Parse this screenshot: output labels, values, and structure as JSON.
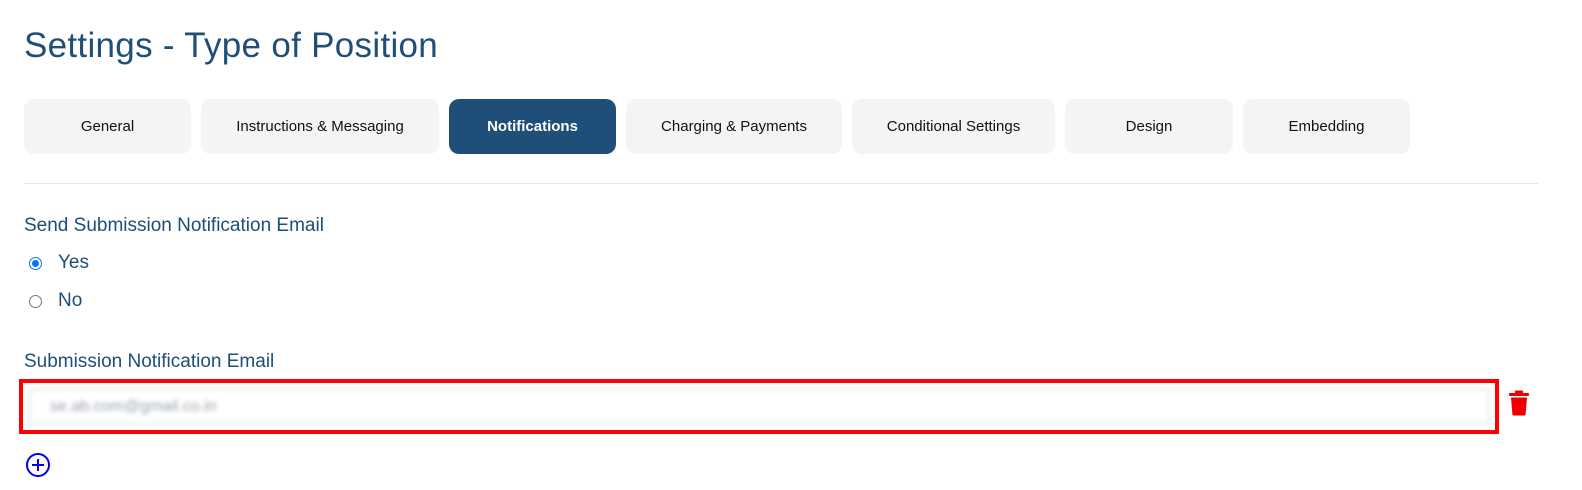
{
  "page": {
    "title": "Settings - Type of Position"
  },
  "tabs": [
    {
      "label": "General",
      "active": false
    },
    {
      "label": "Instructions & Messaging",
      "active": false
    },
    {
      "label": "Notifications",
      "active": true
    },
    {
      "label": "Charging & Payments",
      "active": false
    },
    {
      "label": "Conditional Settings",
      "active": false
    },
    {
      "label": "Design",
      "active": false
    },
    {
      "label": "Embedding",
      "active": false
    }
  ],
  "send_notification": {
    "label": "Send Submission Notification Email",
    "options": [
      {
        "label": "Yes",
        "checked": true
      },
      {
        "label": "No",
        "checked": false
      }
    ]
  },
  "notification_email": {
    "label": "Submission Notification Email",
    "value": "se.ab.com@gmail.co.in"
  },
  "icons": {
    "delete": "trash-icon",
    "add": "plus-circle-icon"
  },
  "colors": {
    "primary": "#1f4e79",
    "tab_bg": "#f2f4f6",
    "highlight": "#ff0000",
    "delete": "#ee0000",
    "add": "#0000ee",
    "radio_accent": "#0075ff"
  }
}
